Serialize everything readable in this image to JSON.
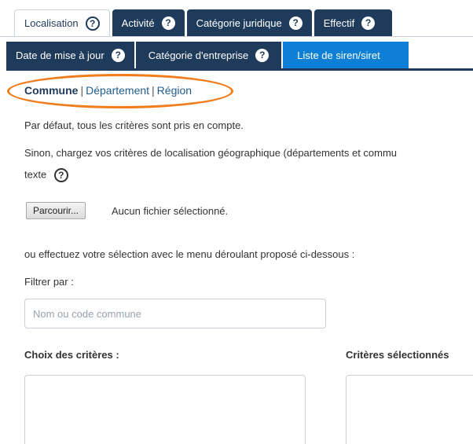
{
  "tabs_row1": [
    {
      "label": "Localisation",
      "state": "active"
    },
    {
      "label": "Activité",
      "state": "inactive"
    },
    {
      "label": "Catégorie juridique",
      "state": "inactive"
    },
    {
      "label": "Effectif",
      "state": "inactive"
    }
  ],
  "tabs_row2": [
    {
      "label": "Date de mise à jour",
      "state": "inactive"
    },
    {
      "label": "Catégorie d'entreprise",
      "state": "inactive"
    },
    {
      "label": "Liste de siren/siret",
      "state": "selected"
    }
  ],
  "help_icon_glyph": "?",
  "subnav": {
    "commune": "Commune",
    "separator": "|",
    "departement": "Département",
    "region": "Région"
  },
  "text": {
    "default_note": "Par défaut, tous les critères sont pris en compte.",
    "load_line1": "Sinon, chargez vos critères de localisation géographique (départements et commu",
    "load_line2": "texte",
    "or_select": "ou effectuez votre sélection avec le menu déroulant proposé ci-dessous :",
    "filter_by": "Filtrer par :"
  },
  "file_upload": {
    "button_label": "Parcourir...",
    "status": "Aucun fichier sélectionné."
  },
  "filter_input": {
    "placeholder": "Nom ou code commune",
    "value": ""
  },
  "criteria": {
    "choices_label": "Choix des critères :",
    "selected_label": "Critères sélectionnés"
  },
  "colors": {
    "nav_dark": "#1f3b5c",
    "nav_selected": "#0d7fd6",
    "highlight": "#f07d1c"
  }
}
